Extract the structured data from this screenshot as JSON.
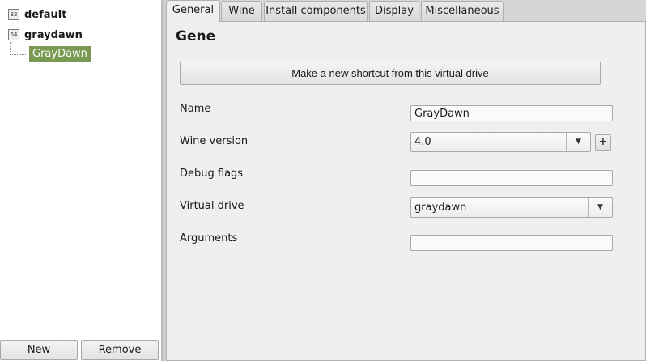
{
  "tree": {
    "nodes": [
      {
        "badge": "32",
        "label": "default"
      },
      {
        "badge": "64",
        "label": "graydawn"
      }
    ],
    "selected_child": "GrayDawn"
  },
  "left_buttons": {
    "new_label": "New",
    "remove_label": "Remove"
  },
  "tabs": [
    "General",
    "Wine",
    "Install components",
    "Display",
    "Miscellaneous"
  ],
  "active_tab": "General",
  "general": {
    "section_title": "Gene",
    "shortcut_button": "Make a new shortcut from this virtual drive",
    "fields": {
      "name": {
        "label": "Name",
        "value": "GrayDawn"
      },
      "wine_version": {
        "label": "Wine version",
        "value": "4.0",
        "add_button": "+"
      },
      "debug_flags": {
        "label": "Debug flags",
        "value": ""
      },
      "virtual_drive": {
        "label": "Virtual drive",
        "value": "graydawn"
      },
      "arguments": {
        "label": "Arguments",
        "value": ""
      }
    }
  },
  "icons": {
    "dropdown": "chevron-down-icon",
    "add": "plus-icon"
  },
  "colors": {
    "selection": "#7a9a52",
    "panel_bg": "#efefef"
  }
}
